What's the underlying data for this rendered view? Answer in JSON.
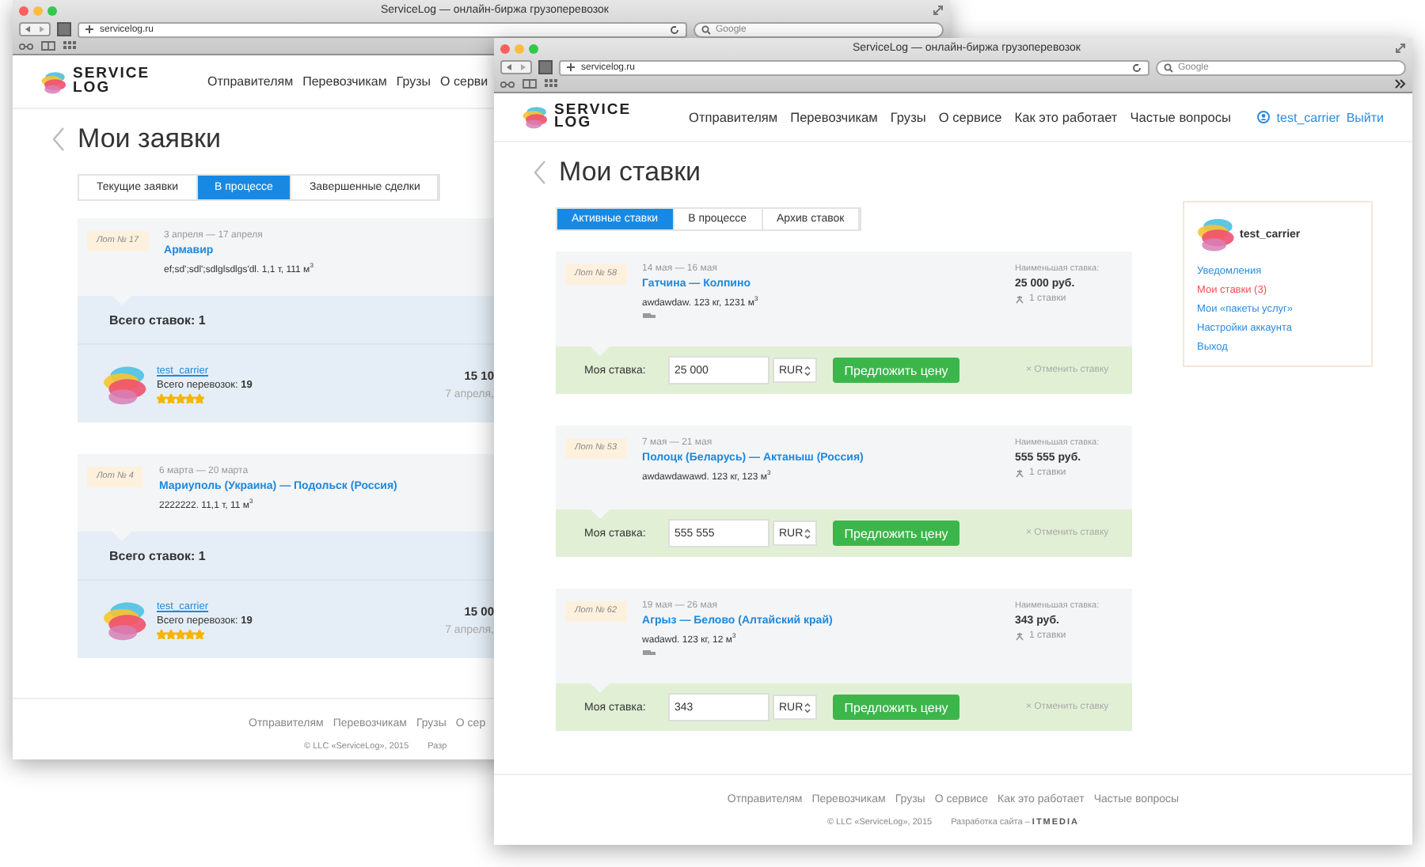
{
  "windows": [
    {
      "kind": "back",
      "title": "ServiceLog — онлайн-биржа грузоперевозок",
      "url": "servicelog.ru",
      "search_placeholder": "Google",
      "logo": [
        "SERVICE",
        "LOG"
      ],
      "nav": [
        "Отправителям",
        "Перевозчикам",
        "Грузы",
        "О серви"
      ],
      "page_title": "Мои заявки",
      "tabs": [
        {
          "label": "Текущие заявки",
          "selected": false
        },
        {
          "label": "В процессе",
          "selected": true
        },
        {
          "label": "Завершенные сделки",
          "selected": false
        }
      ],
      "orders": [
        {
          "lot": "Лот № 17",
          "dates": "3 апреля — 17 апреля",
          "route": "Армавир",
          "cargo": "ef;sd';sdl';sdlglsdlgs'dl. 1,1 т, 111 м$^{3}$",
          "total_bids": "Всего ставок: 1",
          "carrier": {
            "name": "test_carrier",
            "trips": "Всего перевозок: **19**",
            "stars": 5,
            "price": "15 10",
            "date": "7 апреля,"
          }
        },
        {
          "lot": "Лот № 4",
          "dates": "6 марта — 20 марта",
          "route": "Мариуполь (Украина) — Подольск (Россия)",
          "cargo": "2222222. 11,1 т, 11 м$^{3}$",
          "total_bids": "Всего ставок: 1",
          "carrier": {
            "name": "test_carrier",
            "trips": "Всего перевозок: **19**",
            "stars": 5,
            "price": "15 00",
            "date": "7 апреля,"
          }
        }
      ],
      "footer": {
        "links": [
          "Отправителям",
          "Перевозчикам",
          "Грузы",
          "О сер"
        ],
        "copyright": "© LLC «ServiceLog», 2015",
        "credit": "Разр"
      }
    },
    {
      "kind": "front",
      "title": "ServiceLog — онлайн-биржа грузоперевозок",
      "url": "servicelog.ru",
      "search_placeholder": "Google",
      "logo": [
        "SERVICE",
        "LOG"
      ],
      "nav": [
        "Отправителям",
        "Перевозчикам",
        "Грузы",
        "О сервисе",
        "Как это работает",
        "Частые вопросы"
      ],
      "user": {
        "name": "test_carrier",
        "logout": "Выйти"
      },
      "page_title": "Мои ставки",
      "tabs": [
        {
          "label": "Активные ставки",
          "selected": true
        },
        {
          "label": "В процессе",
          "selected": false
        },
        {
          "label": "Архив ставок",
          "selected": false
        }
      ],
      "bids": [
        {
          "lot": "Лот № 58",
          "dates": "14 мая — 16 мая",
          "route": "Гатчина — Колпино",
          "cargo": "awdawdaw. 123 кг, 1231 м$^{3}$",
          "truck": true,
          "min_label": "Наименьшая ставка:",
          "min_value": "25 000 руб.",
          "bid_count": "1 ставки",
          "my_label": "Моя ставка:",
          "my_value": "25 000",
          "currency": "RUR",
          "button": "Предложить цену",
          "cancel": "× Отменить ставку"
        },
        {
          "lot": "Лот № 53",
          "dates": "7 мая — 21 мая",
          "route": "Полоцк (Беларусь) — Актаныш (Россия)",
          "cargo": "awdawdawawd. 123 кг, 123 м$^{3}$",
          "truck": false,
          "min_label": "Наименьшая ставка:",
          "min_value": "555 555 руб.",
          "bid_count": "1 ставки",
          "my_label": "Моя ставка:",
          "my_value": "555 555",
          "currency": "RUR",
          "button": "Предложить цену",
          "cancel": "× Отменить ставку"
        },
        {
          "lot": "Лот № 62",
          "dates": "19 мая — 26 мая",
          "route": "Агрыз — Белово (Алтайский край)",
          "cargo": "wadawd. 123 кг, 12 м$^{3}$",
          "truck": true,
          "min_label": "Наименьшая ставка:",
          "min_value": "343 руб.",
          "bid_count": "1 ставки",
          "my_label": "Моя ставка:",
          "my_value": "343",
          "currency": "RUR",
          "button": "Предложить цену",
          "cancel": "× Отменить ставку"
        }
      ],
      "sidebar": {
        "name": "test_carrier",
        "items": [
          {
            "label": "Уведомления",
            "selected": false
          },
          {
            "label": "Мои ставки (3)",
            "selected": true
          },
          {
            "label": "Мои «пакеты услуг»",
            "selected": false
          },
          {
            "label": "Настройки аккаунта",
            "selected": false
          },
          {
            "label": "Выход",
            "selected": false
          }
        ]
      },
      "footer": {
        "links": [
          "Отправителям",
          "Перевозчикам",
          "Грузы",
          "О сервисе",
          "Как это работает",
          "Частые вопросы"
        ],
        "copyright": "© LLC «ServiceLog», 2015",
        "credit": "Разработка сайта – **ITMEDIA**"
      }
    }
  ]
}
